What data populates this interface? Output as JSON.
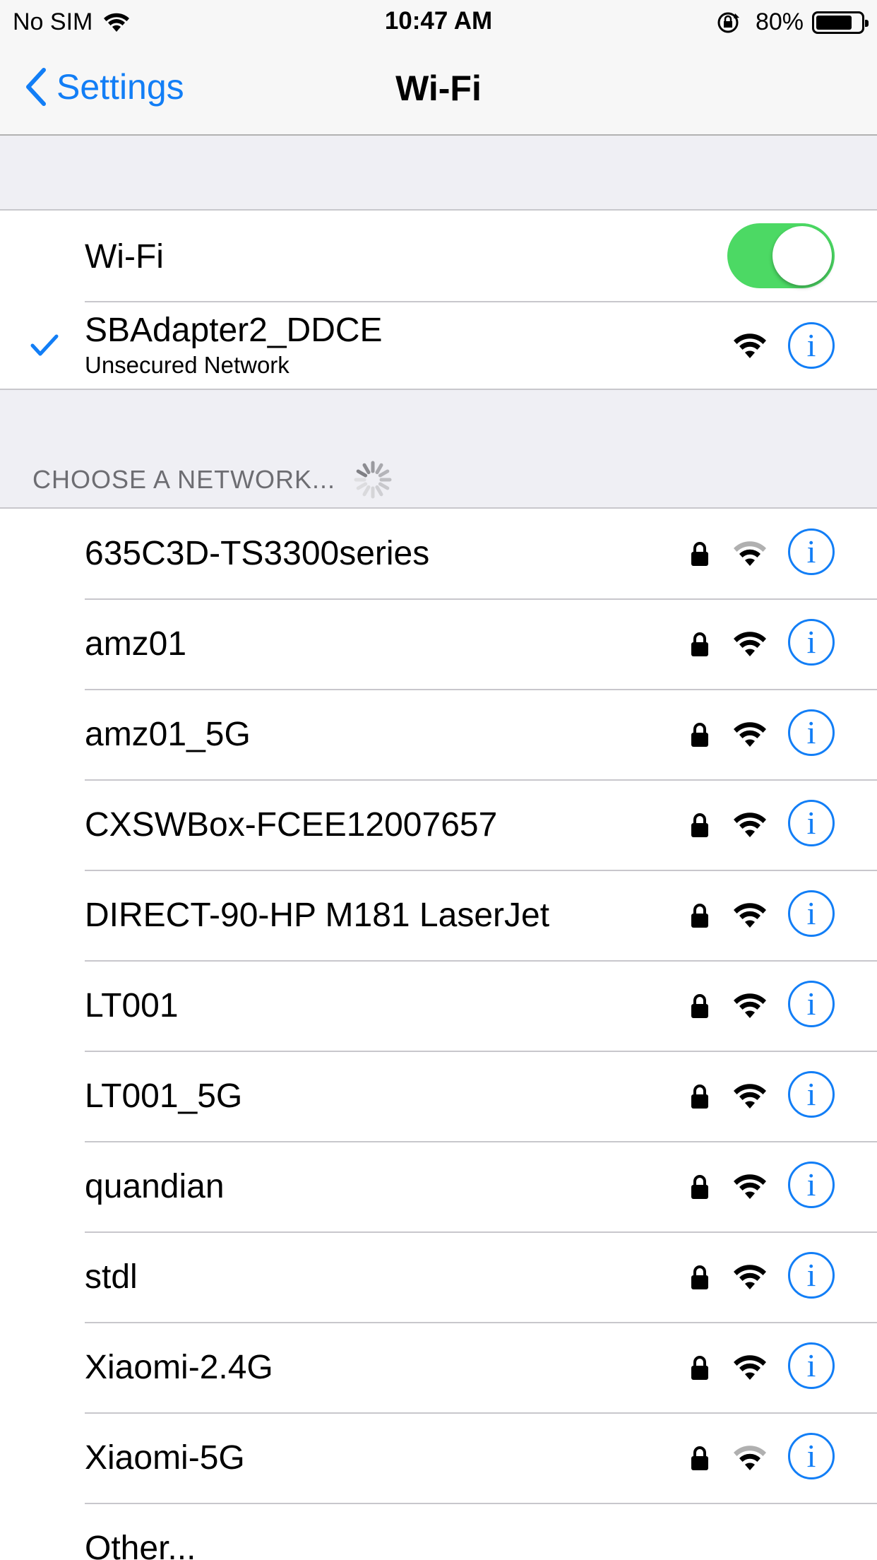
{
  "status_bar": {
    "carrier": "No SIM",
    "time": "10:47 AM",
    "battery_percent": "80%",
    "battery_level": 0.8
  },
  "nav": {
    "back_label": "Settings",
    "title": "Wi-Fi"
  },
  "wifi_toggle": {
    "label": "Wi-Fi",
    "on": true
  },
  "connected_network": {
    "name": "SBAdapter2_DDCE",
    "subtitle": "Unsecured Network"
  },
  "section_header": "CHOOSE A NETWORK...",
  "networks": [
    {
      "name": "635C3D-TS3300series",
      "secured": true,
      "signal": 2
    },
    {
      "name": "amz01",
      "secured": true,
      "signal": 3
    },
    {
      "name": "amz01_5G",
      "secured": true,
      "signal": 3
    },
    {
      "name": "CXSWBox-FCEE12007657",
      "secured": true,
      "signal": 3
    },
    {
      "name": "DIRECT-90-HP M181 LaserJet",
      "secured": true,
      "signal": 3
    },
    {
      "name": "LT001",
      "secured": true,
      "signal": 3
    },
    {
      "name": "LT001_5G",
      "secured": true,
      "signal": 3
    },
    {
      "name": "quandian",
      "secured": true,
      "signal": 3
    },
    {
      "name": "stdl",
      "secured": true,
      "signal": 3
    },
    {
      "name": "Xiaomi-2.4G",
      "secured": true,
      "signal": 3
    },
    {
      "name": "Xiaomi-5G",
      "secured": true,
      "signal": 2
    }
  ],
  "other_label": "Other...",
  "colors": {
    "accent": "#127ef6",
    "toggle_on": "#4cd964",
    "background": "#efeff4"
  }
}
